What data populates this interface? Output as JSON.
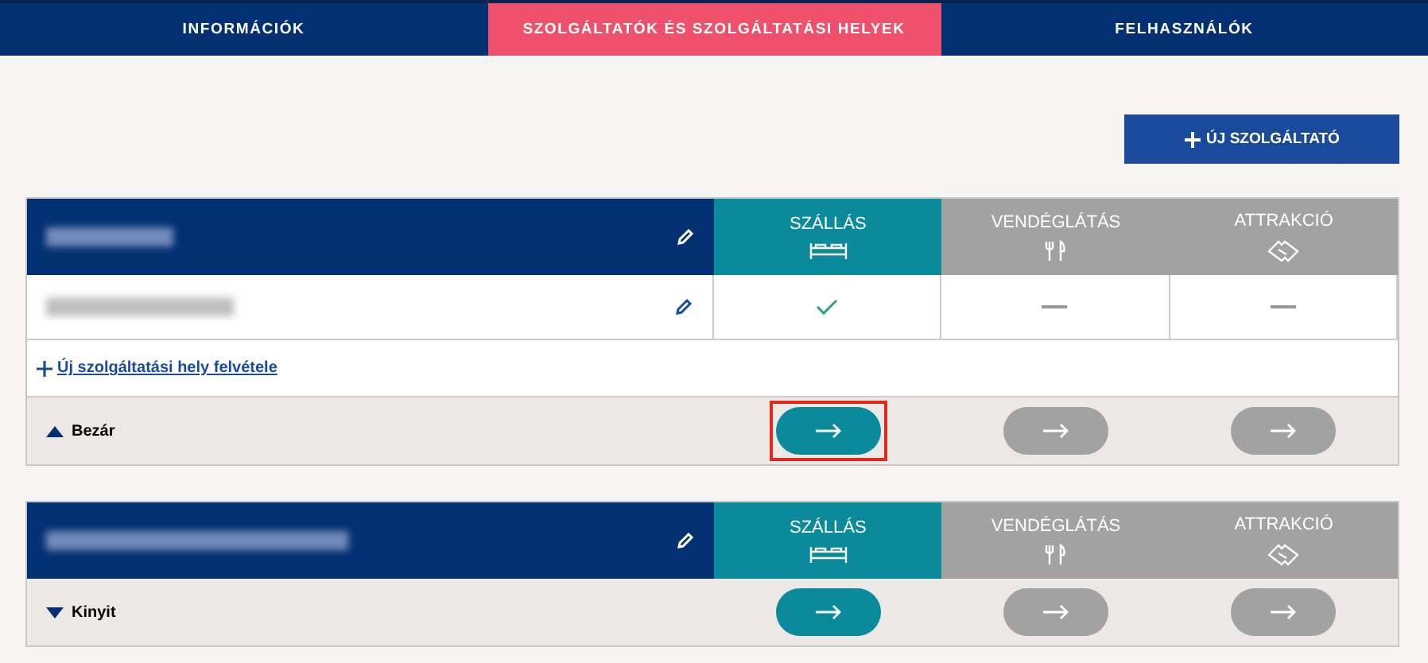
{
  "nav_tabs": [
    {
      "label": "INFORMÁCIÓK",
      "selected": false
    },
    {
      "label": "SZOLGÁLTATÓK ÉS SZOLGÁLTATÁSI HELYEK",
      "selected": true
    },
    {
      "label": "FELHASZNÁLÓK",
      "selected": false
    }
  ],
  "new_provider_button": {
    "label": "ÚJ SZOLGÁLTATÓ"
  },
  "providers": [
    {
      "expanded": true,
      "toggle_label": "Bezár",
      "add_place_link": "Új szolgáltatási hely felvétele",
      "categories": [
        {
          "label": "SZÁLLÁS",
          "kind": "bed",
          "active": true,
          "highlighted": true
        },
        {
          "label": "VENDÉGLÁTÁS",
          "kind": "cutlery",
          "active": false,
          "highlighted": false
        },
        {
          "label": "ATTRAKCIÓ",
          "kind": "ticket",
          "active": false,
          "highlighted": false
        }
      ],
      "places": [
        {
          "marks": [
            {
              "kind": "check"
            },
            {
              "kind": "dash"
            },
            {
              "kind": "dash"
            }
          ]
        }
      ]
    },
    {
      "expanded": false,
      "toggle_label": "Kinyit",
      "categories": [
        {
          "label": "SZÁLLÁS",
          "kind": "bed",
          "active": true,
          "highlighted": false
        },
        {
          "label": "VENDÉGLÁTÁS",
          "kind": "cutlery",
          "active": false,
          "highlighted": false
        },
        {
          "label": "ATTRAKCIÓ",
          "kind": "ticket",
          "active": false,
          "highlighted": false
        }
      ]
    }
  ]
}
